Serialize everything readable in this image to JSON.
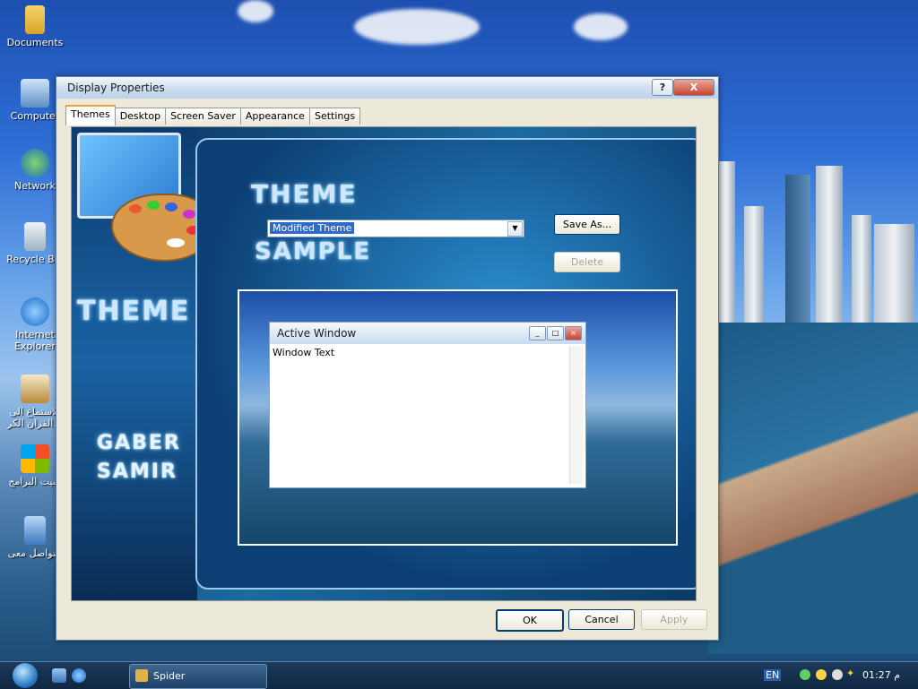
{
  "desktop": {
    "icons": [
      {
        "label": "Documents"
      },
      {
        "label": "Computer"
      },
      {
        "label": "Network"
      },
      {
        "label": "Recycle Bin"
      },
      {
        "label": "Internet Explorer"
      },
      {
        "label": "الاستماع الى القران الكر..."
      },
      {
        "label": "تثبيت البرامج"
      },
      {
        "label": "للتواصل معى"
      }
    ]
  },
  "window": {
    "title": "Display Properties",
    "help_label": "?",
    "close_label": "X",
    "tabs": [
      {
        "label": "Themes"
      },
      {
        "label": "Desktop"
      },
      {
        "label": "Screen Saver"
      },
      {
        "label": "Appearance"
      },
      {
        "label": "Settings"
      }
    ],
    "theme_combo_value": "Modified Theme",
    "save_as_label": "Save As...",
    "delete_label": "Delete",
    "graphic_text": {
      "theme_top": "THEME",
      "sample": "SAMPLE",
      "theme_left": "THEME",
      "author_line1": "GABER",
      "author_line2": "SAMIR"
    },
    "preview": {
      "window_title": "Active Window",
      "window_text": "Window Text"
    },
    "ok_label": "OK",
    "cancel_label": "Cancel",
    "apply_label": "Apply"
  },
  "taskbar": {
    "task_label": "Spider",
    "language": "EN",
    "clock": "01:27 م"
  },
  "colors": {
    "accent": "#316ac5",
    "close_red": "#c8452f",
    "tab_highlight": "#e8a33d"
  }
}
